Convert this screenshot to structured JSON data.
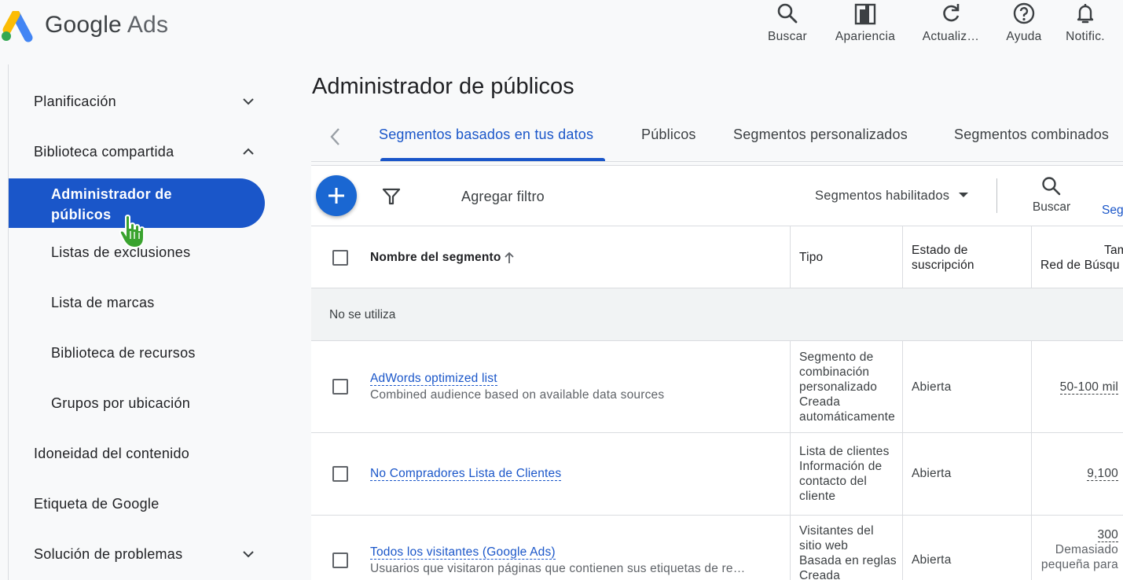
{
  "brand": {
    "google": "Google",
    "ads": "Ads"
  },
  "toolbar_top": [
    {
      "icon": "search-icon",
      "label": "Buscar"
    },
    {
      "icon": "appearance-icon",
      "label": "Apariencia"
    },
    {
      "icon": "refresh-icon",
      "label": "Actualiz…"
    },
    {
      "icon": "help-icon",
      "label": "Ayuda"
    },
    {
      "icon": "bell-icon",
      "label": "Notific."
    }
  ],
  "sidebar": {
    "items": [
      {
        "label": "Planificación"
      },
      {
        "label": "Biblioteca compartida"
      },
      {
        "label": "Administrador de públicos"
      },
      {
        "label": "Listas de exclusiones"
      },
      {
        "label": "Lista de marcas"
      },
      {
        "label": "Biblioteca de recursos"
      },
      {
        "label": "Grupos por ubicación"
      },
      {
        "label": "Idoneidad del contenido"
      },
      {
        "label": "Etiqueta de Google"
      },
      {
        "label": "Solución de problemas"
      }
    ]
  },
  "page": {
    "title": "Administrador de públicos"
  },
  "tabs": [
    {
      "label": "Segmentos basados en tus datos"
    },
    {
      "label": "Públicos"
    },
    {
      "label": "Segmentos personalizados"
    },
    {
      "label": "Segmentos combinados"
    }
  ],
  "table_toolbar": {
    "add_filter": "Agregar filtro",
    "segment_filter": "Segmentos habilitados",
    "search_label": "Buscar",
    "segments_link": "Seg"
  },
  "table": {
    "headers": {
      "name": "Nombre del segmento",
      "type": "Tipo",
      "status_line1": "Estado de",
      "status_line2": "suscripción",
      "size_line1": "Tama",
      "size_line2": "Red de Búsqu"
    },
    "group_label": "No se utiliza",
    "rows": [
      {
        "name": "AdWords optimized list",
        "description": "Combined audience based on available data sources",
        "type_lines": [
          "Segmento de",
          "combinación",
          "personalizado",
          "Creada",
          "automáticamente"
        ],
        "status": "Abierta",
        "size": "50-100 mil",
        "size_note": [
          "",
          ""
        ]
      },
      {
        "name": "No Compradores Lista de Clientes",
        "description": "",
        "type_lines": [
          "Lista de clientes",
          "Información de",
          "contacto del",
          "cliente"
        ],
        "status": "Abierta",
        "size": "9,100",
        "size_note": [
          "",
          ""
        ]
      },
      {
        "name": "Todos los visitantes (Google Ads)",
        "description": "Usuarios que visitaron páginas que contienen sus etiquetas de re…",
        "type_lines": [
          "Visitantes del",
          "sitio web",
          "Basada en reglas",
          "Creada"
        ],
        "status": "Abierta",
        "size": "300",
        "size_note": [
          "Demasiado",
          "pequeña para"
        ]
      }
    ]
  },
  "colors": {
    "accent": "#1a56c9",
    "fab": "#1a67d2",
    "cursor": "#3aa32f"
  }
}
